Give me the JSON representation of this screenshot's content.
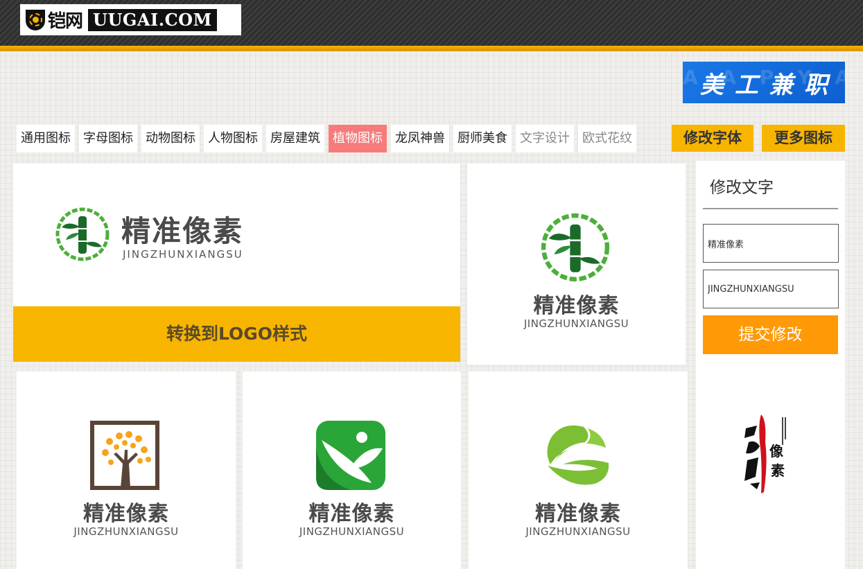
{
  "header": {
    "logo_cn": "铠网",
    "logo_en": "UUGAI.COM"
  },
  "ad": {
    "text": "美工兼职"
  },
  "tabs": [
    {
      "label": "通用图标",
      "state": "normal"
    },
    {
      "label": "字母图标",
      "state": "normal"
    },
    {
      "label": "动物图标",
      "state": "normal"
    },
    {
      "label": "人物图标",
      "state": "normal"
    },
    {
      "label": "房屋建筑",
      "state": "normal"
    },
    {
      "label": "植物图标",
      "state": "active"
    },
    {
      "label": "龙凤神兽",
      "state": "normal"
    },
    {
      "label": "厨师美食",
      "state": "normal"
    },
    {
      "label": "文字设计",
      "state": "muted"
    },
    {
      "label": "欧式花纹",
      "state": "muted"
    }
  ],
  "buttons": {
    "edit_font": "修改字体",
    "more_icons": "更多图标"
  },
  "cards": {
    "brand_name": "精准像素",
    "brand_pinyin": "JINGZHUNXIANGSU",
    "convert_label": "转换到LOGO样式"
  },
  "sidebar": {
    "title": "修改文字",
    "name_value": "精准像素",
    "pinyin_value": "JINGZHUNXIANGSU",
    "submit_label": "提交修改"
  },
  "colors": {
    "accent": "#f8b500",
    "active_tab": "#f77b7b",
    "submit": "#ff9a06",
    "ad": "#1a78e6"
  }
}
